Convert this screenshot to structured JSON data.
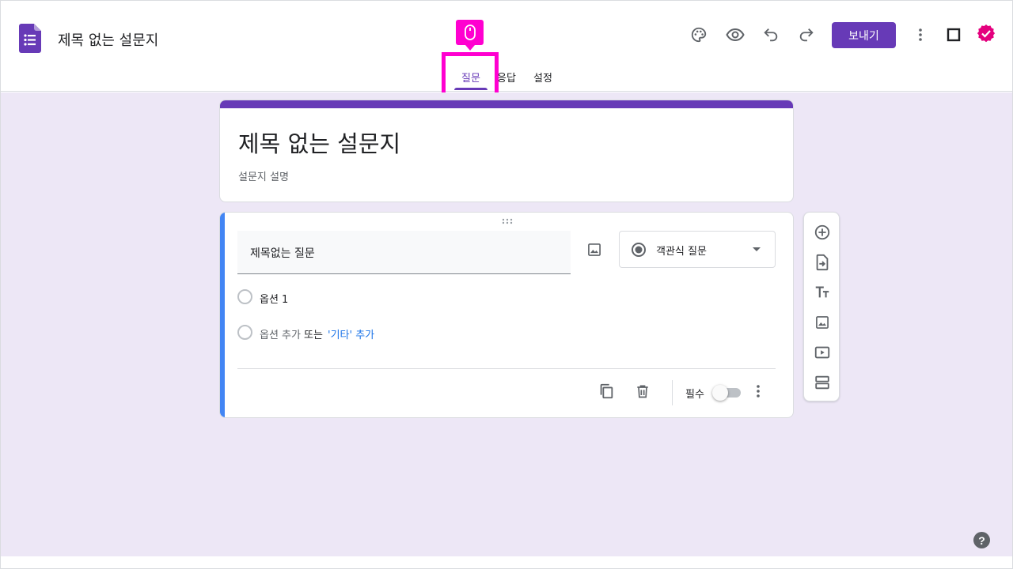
{
  "header": {
    "title": "제목 없는 설문지",
    "send_label": "보내기",
    "icons": [
      "palette-icon",
      "eye-icon",
      "undo-icon",
      "redo-icon",
      "more-vert-icon",
      "square-icon"
    ]
  },
  "tabs": [
    {
      "label": "질문",
      "active": true
    },
    {
      "label": "응답",
      "active": false
    },
    {
      "label": "설정",
      "active": false
    }
  ],
  "form": {
    "title": "제목 없는 설문지",
    "description": "설문지 설명"
  },
  "question": {
    "title": "제목없는 질문",
    "type": "객관식 질문",
    "option1": "옵션 1",
    "add_option": "옵션 추가",
    "or": "또는",
    "add_other": "'기타' 추가",
    "required_label": "필수",
    "required": false
  },
  "help": {
    "label": "?"
  },
  "colors": {
    "accent": "#673ab7",
    "canvas_bg": "#ede7f6",
    "active_card_bar": "#4285f4",
    "highlight": "#ff00d0",
    "link": "#1a73e8"
  }
}
